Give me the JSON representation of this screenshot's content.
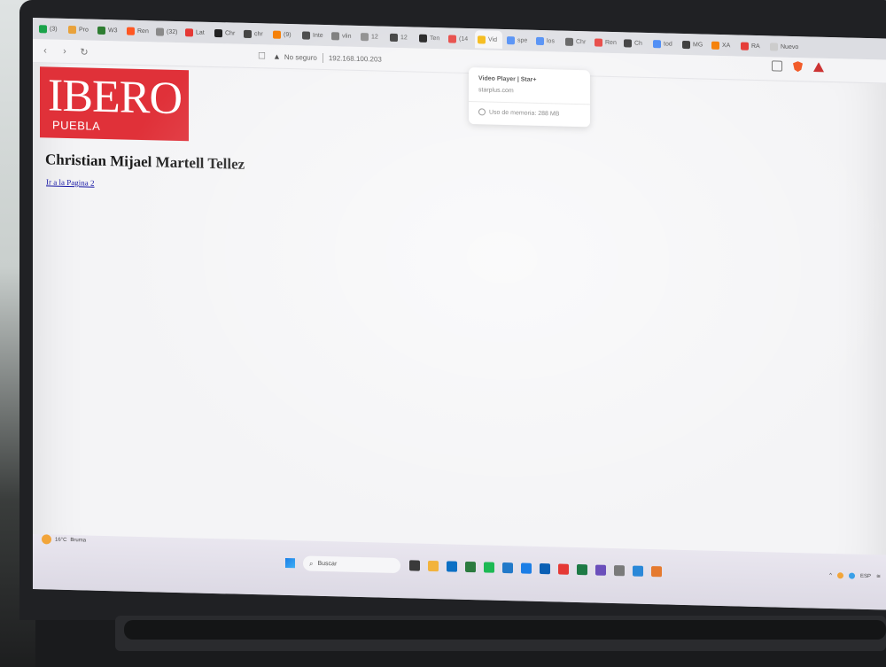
{
  "browser": {
    "tabs": [
      {
        "label": "(3)",
        "color": "#1aa34a"
      },
      {
        "label": "Pro",
        "color": "#e9a23b"
      },
      {
        "label": "W3",
        "color": "#2e7d32"
      },
      {
        "label": "Ren",
        "color": "#ff5722"
      },
      {
        "label": "(32)",
        "color": "#8a8a8a"
      },
      {
        "label": "Lat",
        "color": "#e53935"
      },
      {
        "label": "Chr",
        "color": "#222222"
      },
      {
        "label": "chr",
        "color": "#444444"
      },
      {
        "label": "(9)",
        "color": "#f57c00"
      },
      {
        "label": "Inte",
        "color": "#444444"
      },
      {
        "label": "vlin",
        "color": "#777777"
      },
      {
        "label": "12",
        "color": "#888888"
      },
      {
        "label": "12",
        "color": "#333333"
      },
      {
        "label": "Ten",
        "color": "#111111"
      },
      {
        "label": "(14",
        "color": "#e53935"
      },
      {
        "label": "Vid",
        "color": "#f4b400"
      },
      {
        "label": "spe",
        "color": "#4285f4"
      },
      {
        "label": "los",
        "color": "#4285f4"
      },
      {
        "label": "Chr",
        "color": "#555555"
      },
      {
        "label": "Ren",
        "color": "#e53935"
      },
      {
        "label": "Ch",
        "color": "#333333"
      },
      {
        "label": "tod",
        "color": "#4285f4"
      },
      {
        "label": "MG",
        "color": "#333333"
      },
      {
        "label": "XA",
        "color": "#f57c00"
      },
      {
        "label": "RA",
        "color": "#e53935"
      },
      {
        "label": "Nuevo",
        "color": "#cccccc"
      }
    ],
    "nav": {
      "back": "‹",
      "forward": "›",
      "reload": "↻"
    },
    "omnibox": {
      "security_label": "No seguro",
      "url": "192.168.100.203"
    },
    "hover_card": {
      "title": "Video Player | Star+",
      "domain": "starplus.com",
      "memory": "Uso de memoria: 288 MB"
    }
  },
  "page": {
    "logo": {
      "main": "IBERO",
      "sub": "PUEBLA",
      "color": "#e03139"
    },
    "heading": "Christian Mijael Martell Tellez",
    "link": "Ir a la Pagina 2"
  },
  "taskbar": {
    "weather": {
      "temp": "16°C",
      "condition": "Bruma"
    },
    "search_placeholder": "Buscar",
    "apps": [
      "#3a3a3a",
      "#f2b33d",
      "#0b6fc4",
      "#2b7b3f",
      "#1db954",
      "#2279c9",
      "#1c7ee6",
      "#0a5fb4",
      "#e53935",
      "#1d7a45",
      "#6b4fbb",
      "#7a7a7a",
      "#2a88d8",
      "#e57a2f"
    ],
    "tray": {
      "language": "ESP"
    }
  }
}
